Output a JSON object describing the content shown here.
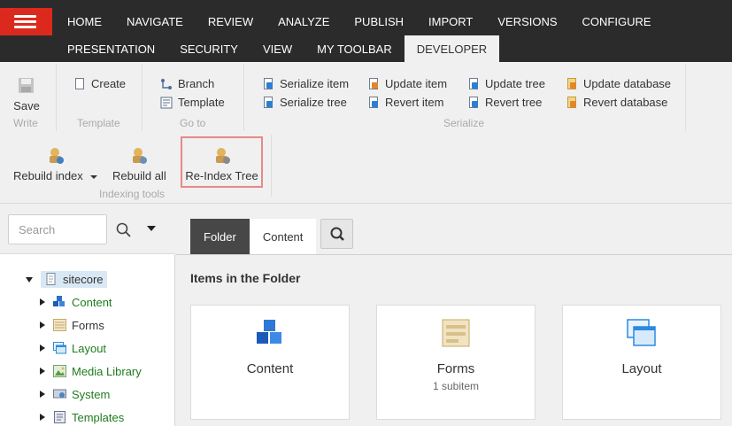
{
  "nav": {
    "row1": [
      "HOME",
      "NAVIGATE",
      "REVIEW",
      "ANALYZE",
      "PUBLISH",
      "IMPORT",
      "VERSIONS",
      "CONFIGURE"
    ],
    "row2": [
      "PRESENTATION",
      "SECURITY",
      "VIEW",
      "MY TOOLBAR",
      "DEVELOPER"
    ],
    "active": "DEVELOPER"
  },
  "ribbon": {
    "write": {
      "save": "Save",
      "group": "Write"
    },
    "template": {
      "create": "Create",
      "group": "Template"
    },
    "goto": {
      "branch": "Branch",
      "template": "Template",
      "group": "Go to"
    },
    "serialize": {
      "serialize_item": "Serialize item",
      "serialize_tree": "Serialize tree",
      "update_item": "Update item",
      "revert_item": "Revert item",
      "update_tree": "Update tree",
      "revert_tree": "Revert tree",
      "update_database": "Update database",
      "revert_database": "Revert database",
      "group": "Serialize"
    },
    "indexing": {
      "rebuild_index": "Rebuild index",
      "rebuild_all": "Rebuild all",
      "reindex_tree": "Re-Index Tree",
      "group": "Indexing tools"
    },
    "highlight_color": "#e58a8a"
  },
  "search": {
    "placeholder": "Search"
  },
  "tree": {
    "root": "sitecore",
    "children": [
      "Content",
      "Forms",
      "Layout",
      "Media Library",
      "System",
      "Templates"
    ]
  },
  "main": {
    "tabs": [
      "Folder",
      "Content"
    ],
    "active_tab": "Folder",
    "section_title": "Items in the Folder",
    "cards": [
      {
        "title": "Content",
        "subtitle": "",
        "icon": "cubes-icon"
      },
      {
        "title": "Forms",
        "subtitle": "1 subitem",
        "icon": "form-icon"
      },
      {
        "title": "Layout",
        "subtitle": "",
        "icon": "windows-icon"
      }
    ]
  },
  "colors": {
    "topbar": "#2b2b2b",
    "hamburger": "#dc291e",
    "tree_link": "#1e7c1e",
    "active_tab": "#474747"
  }
}
